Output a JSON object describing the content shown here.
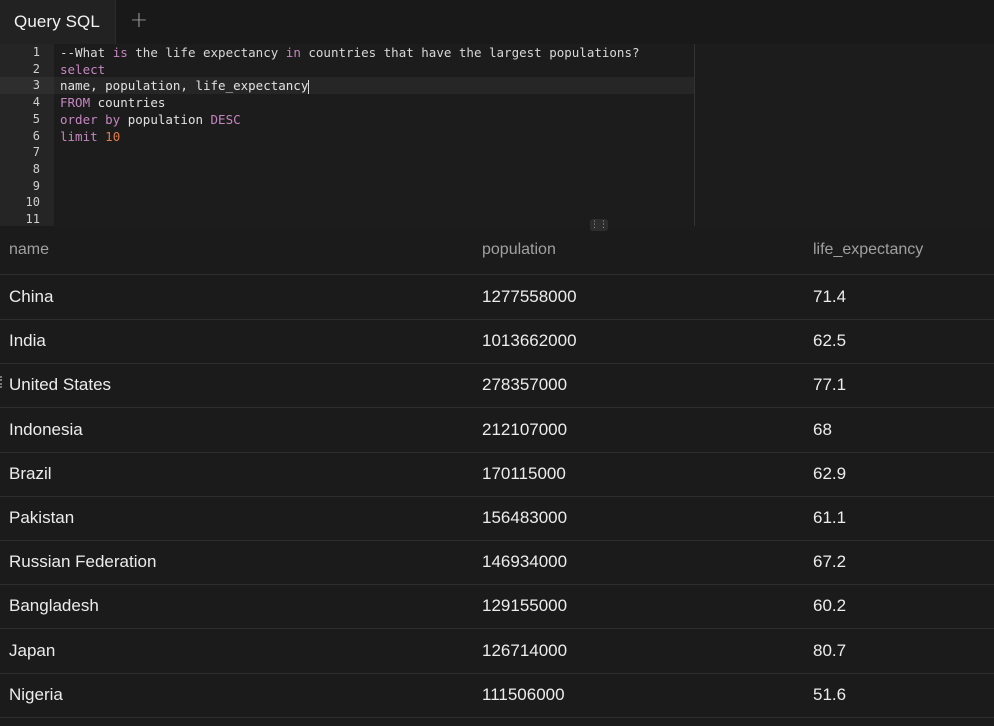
{
  "tabs": {
    "active_label": "Query SQL",
    "add_label": "+"
  },
  "editor": {
    "line_numbers": [
      "1",
      "2",
      "3",
      "4",
      "5",
      "6",
      "7",
      "8",
      "9",
      "10",
      "11"
    ],
    "lines": [
      [
        {
          "t": "comment",
          "v": "--What "
        },
        {
          "t": "kw",
          "v": "is"
        },
        {
          "t": "comment",
          "v": " the life expectancy "
        },
        {
          "t": "kw",
          "v": "in"
        },
        {
          "t": "comment",
          "v": " countries that have the largest populations?"
        }
      ],
      [
        {
          "t": "kw",
          "v": "select"
        }
      ],
      [
        {
          "t": "plain",
          "v": "name, population, life_expectancy"
        }
      ],
      [
        {
          "t": "kw",
          "v": "FROM"
        },
        {
          "t": "plain",
          "v": " countries"
        }
      ],
      [
        {
          "t": "kw",
          "v": "order by"
        },
        {
          "t": "plain",
          "v": " population "
        },
        {
          "t": "kw",
          "v": "DESC"
        }
      ],
      [
        {
          "t": "kw",
          "v": "limit"
        },
        {
          "t": "plain",
          "v": " "
        },
        {
          "t": "num",
          "v": "10"
        }
      ],
      [],
      [],
      [],
      [],
      []
    ],
    "active_line": 3
  },
  "results": {
    "columns": [
      "name",
      "population",
      "life_expectancy"
    ],
    "rows": [
      [
        "China",
        "1277558000",
        "71.4"
      ],
      [
        "India",
        "1013662000",
        "62.5"
      ],
      [
        "United States",
        "278357000",
        "77.1"
      ],
      [
        "Indonesia",
        "212107000",
        "68"
      ],
      [
        "Brazil",
        "170115000",
        "62.9"
      ],
      [
        "Pakistan",
        "156483000",
        "61.1"
      ],
      [
        "Russian Federation",
        "146934000",
        "67.2"
      ],
      [
        "Bangladesh",
        "129155000",
        "60.2"
      ],
      [
        "Japan",
        "126714000",
        "80.7"
      ],
      [
        "Nigeria",
        "111506000",
        "51.6"
      ]
    ]
  },
  "colors": {
    "keyword": "#c586c0",
    "number": "#e07a4a",
    "background": "#1b1b1b"
  },
  "icons": {
    "resize_handle": "drag-handle-icon"
  }
}
